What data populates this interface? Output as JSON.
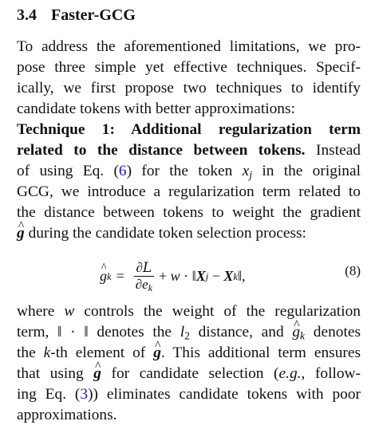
{
  "section": {
    "number": "3.4",
    "title": "Faster-GCG"
  },
  "intro_lines": [
    "To address the aforementioned limitations, we pro-",
    "pose three simple yet effective techniques. Specif-",
    "ically, we first propose two techniques to identify",
    "candidate tokens with better approximations:"
  ],
  "technique": {
    "bold_line1": "Technique 1: Additional regularization term",
    "bold_line2": "related to the distance between tokens.",
    "after_bold": "Instead"
  },
  "para": {
    "l3a": "of using Eq. (",
    "ref_eq6": "6",
    "l3b": ") for the token",
    "var_x": "x",
    "var_x_sub": "j",
    "l3c": "in the original",
    "l4": "GCG, we introduce a regularization term related to",
    "l5": "the distance between tokens to weight the gradient",
    "var_g": "g",
    "l6": "during the candidate token selection process:"
  },
  "equation": {
    "lhs_var": "g",
    "lhs_sub": "k",
    "equals": "=",
    "num": "∂",
    "num_script": "L",
    "den": "∂e",
    "den_sub": "k",
    "plus": "+ ",
    "w": "w",
    "cdot": " · ‖",
    "X1": "X",
    "X1_sub": "j",
    "minus": " − ",
    "X2": "X",
    "X2_sub": "k",
    "close": "‖,",
    "number": "(8)"
  },
  "after_eq": {
    "l1a": "where",
    "w": "w",
    "l1b": "controls the weight of the regularization",
    "l2a": "term, ‖ · ‖ denotes the",
    "l2_var": "l",
    "l2_sub": "2",
    "l2b": "distance, and",
    "l2_g": "g",
    "l2_gsub": "k",
    "l2c": "denotes",
    "l3a": "the",
    "l3_k": "k",
    "l3b": "-th element of",
    "l3_g": "g",
    "l3c": ". This additional term ensures",
    "l4a": "that using",
    "l4_g": "g",
    "l4b": "for candidate selection (",
    "l4_eg": "e.g.",
    "l4c": ", follow-",
    "l5a": "ing Eq. (",
    "ref_eq3": "3",
    "l5b": ")) eliminates candidate tokens with poor",
    "l6": "approximations."
  }
}
